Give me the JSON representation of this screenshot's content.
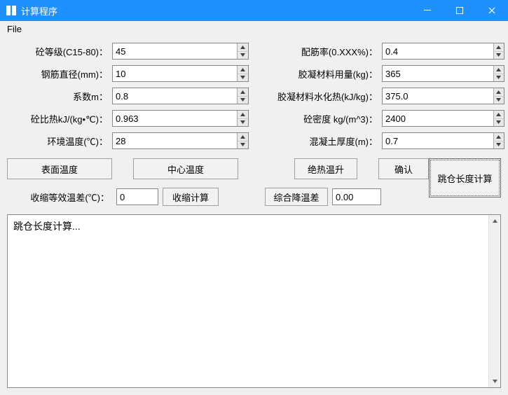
{
  "window": {
    "title": "计算程序"
  },
  "menu": {
    "file": "File"
  },
  "form": {
    "left": [
      {
        "label": "砼等级(C15-80)：",
        "value": "45"
      },
      {
        "label": "钢筋直径(mm)：",
        "value": "10"
      },
      {
        "label": "系数m：",
        "value": "0.8"
      },
      {
        "label": "砼比热kJ/(kg•℃)：",
        "value": "0.963"
      },
      {
        "label": "环境温度(℃)：",
        "value": "28"
      }
    ],
    "right": [
      {
        "label": "配筋率(0.XXX%)：",
        "value": "0.4"
      },
      {
        "label": "胶凝材料用量(kg)：",
        "value": "365"
      },
      {
        "label": "胶凝材料水化热(kJ/kg)：",
        "value": "375.0"
      },
      {
        "label": "砼密度 kg/(m^3)：",
        "value": "2400"
      },
      {
        "label": "混凝土厚度(m)：",
        "value": "0.7"
      }
    ]
  },
  "buttons": {
    "surface_temp": "表面温度",
    "center_temp": "中心温度",
    "adiabatic_rise": "绝热温升",
    "confirm": "确认",
    "jump_length": "跳仓长度计算",
    "shrink_calc": "收缩计算",
    "composite_cooling": "综合降温差"
  },
  "shrink": {
    "label": "收缩等效温差(℃)：",
    "value": "0"
  },
  "composite": {
    "value": "0.00"
  },
  "output": {
    "text": "跳仓长度计算..."
  }
}
